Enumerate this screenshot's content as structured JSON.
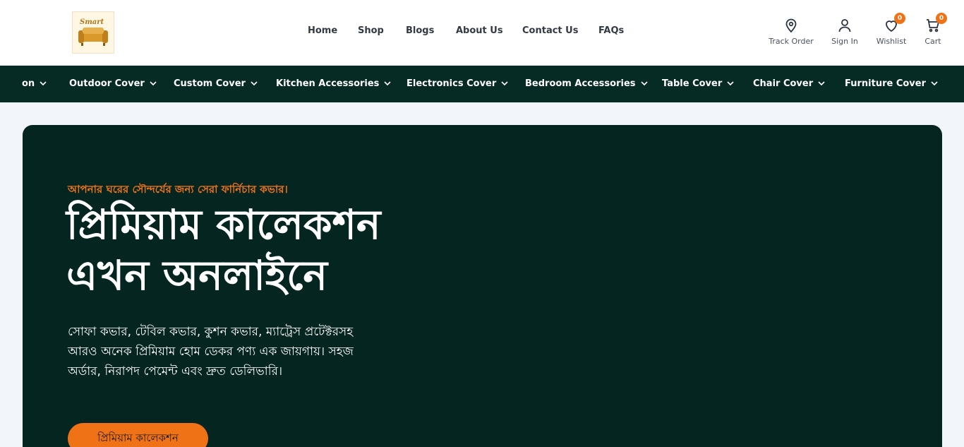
{
  "header": {
    "logo_alt": "Smart",
    "nav": [
      {
        "label": "Home"
      },
      {
        "label": "Shop"
      },
      {
        "label": "Blogs"
      },
      {
        "label": "About Us"
      },
      {
        "label": "Contact Us"
      },
      {
        "label": "FAQs"
      }
    ],
    "utilities": {
      "track_order": "Track Order",
      "sign_in": "Sign In",
      "wishlist": "Wishlist",
      "wishlist_count": "0",
      "cart": "Cart",
      "cart_count": "0"
    }
  },
  "categories": [
    {
      "label": "on"
    },
    {
      "label": "Outdoor Cover"
    },
    {
      "label": "Custom Cover"
    },
    {
      "label": "Kitchen Accessories"
    },
    {
      "label": "Electronics Cover"
    },
    {
      "label": "Bedroom Accessories"
    },
    {
      "label": "Table Cover"
    },
    {
      "label": "Chair Cover"
    },
    {
      "label": "Furniture Cover"
    }
  ],
  "hero": {
    "tagline": "আপনার ঘরের সৌন্দর্যের জন্য সেরা ফার্নিচার কভার।",
    "title_line1": "প্রিমিয়াম কালেকশন",
    "title_line2": "এখন অনলাইনে",
    "description": "সোফা কভার, টেবিল কভার, কুশন কভার, ম্যাট্রেস প্রটেক্টরসহ আরও অনেক প্রিমিয়াম হোম ডেকর পণ্য এক জায়গায়। সহজ অর্ডার, নিরাপদ পেমেন্ট এবং দ্রুত ডেলিভারি।",
    "cta": "প্রিমিয়াম কালেকশন"
  },
  "colors": {
    "accent": "#f07216",
    "dark_green": "#052520",
    "catbar": "#062a24"
  }
}
